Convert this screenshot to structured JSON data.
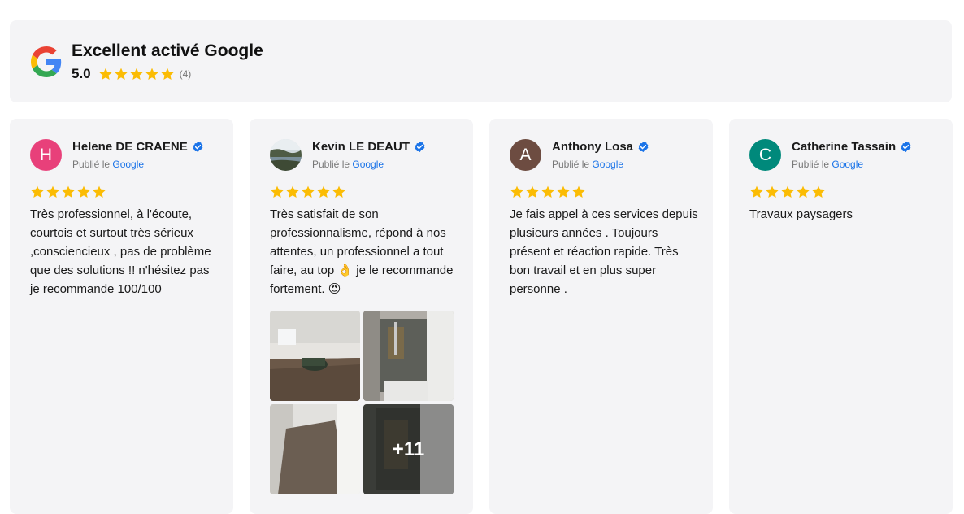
{
  "header": {
    "title": "Excellent activé Google",
    "score": "5.0",
    "count": "(4)",
    "stars": 5
  },
  "colors": {
    "star": "#fbbc04",
    "verified": "#1a73e8",
    "link": "#1a73e8",
    "card_bg": "#f4f4f6"
  },
  "published_prefix": "Publié le",
  "published_source": "Google",
  "reviews": [
    {
      "initial": "H",
      "avatar_color": "#e8407a",
      "name": "Helene DE CRAENE",
      "rating": 5,
      "text": "Très professionnel, à l'écoute, courtois et surtout très sérieux ,consciencieux , pas de problème que des solutions !! n'hésitez pas je recommande 100/100"
    },
    {
      "initial": "",
      "avatar_color": "#5b6b52",
      "name": "Kevin LE DEAUT",
      "rating": 5,
      "text_before_emoji": "Très satisfait de son professionnalisme, répond à nos attentes, un professionnel a tout faire, au top ",
      "emoji1": "👌",
      "text_middle": " je le recommande fortement. ",
      "emoji2": "😍",
      "more_photos": "+11"
    },
    {
      "initial": "A",
      "avatar_color": "#6d4c41",
      "name": "Anthony Losa",
      "rating": 5,
      "text": "Je fais appel à ces services depuis plusieurs années . Toujours présent et réaction rapide. Très bon travail et en plus super personne ."
    },
    {
      "initial": "C",
      "avatar_color": "#00897b",
      "name": "Catherine Tassain",
      "rating": 5,
      "text": "Travaux paysagers"
    }
  ]
}
